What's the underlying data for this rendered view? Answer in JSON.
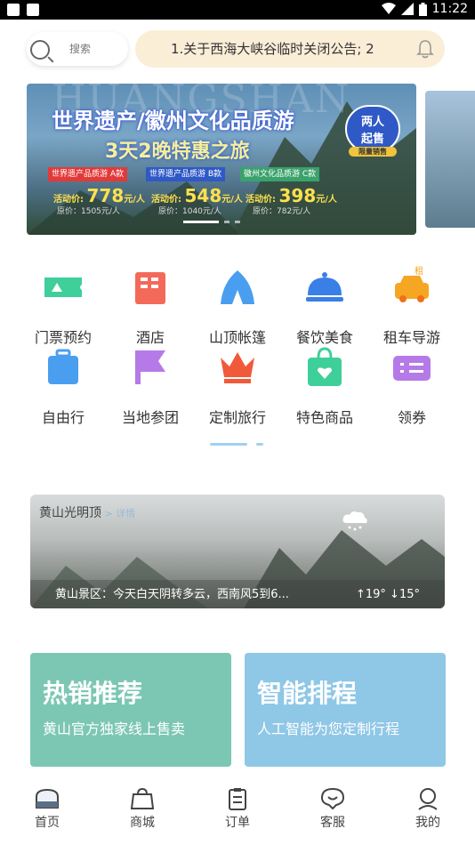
{
  "status_bar": {
    "time": "11:22"
  },
  "search": {
    "placeholder": "搜索"
  },
  "notice": {
    "text": "1.关于西海大峡谷临时关闭公告; 2"
  },
  "banner": {
    "bg_text": "HUANGSHAN",
    "title": "世界遗产/徽州文化品质游",
    "subtitle": "3天2晚特惠之旅",
    "badge_line1": "两人",
    "badge_line2": "起售",
    "badge_small": "限量销售",
    "tags": [
      "世界遗产品质游 A款",
      "世界遗产品质游 B款",
      "徽州文化品质游 C款"
    ],
    "tag_colors": [
      "#e23a3a",
      "#2f59c6",
      "#3aa26b"
    ],
    "prices": [
      {
        "label": "活动价: ",
        "value": "778",
        "unit": "元/人",
        "orig": "原价：1505元/人"
      },
      {
        "label": "活动价: ",
        "value": "548",
        "unit": "元/人",
        "orig": "原价：1040元/人"
      },
      {
        "label": "活动价: ",
        "value": "398",
        "unit": "元/人",
        "orig": "原价：782元/人"
      }
    ]
  },
  "grid": [
    {
      "label": "门票预约",
      "icon": "ticket-icon",
      "color": "#3fcf9a"
    },
    {
      "label": "酒店",
      "icon": "hotel-icon",
      "color": "#f36a5a"
    },
    {
      "label": "山顶帐篷",
      "icon": "tent-icon",
      "color": "#4a9ef0"
    },
    {
      "label": "餐饮美食",
      "icon": "food-icon",
      "color": "#3a7fe6"
    },
    {
      "label": "租车导游",
      "icon": "car-icon",
      "color": "#f5a623"
    },
    {
      "label": "自由行",
      "icon": "luggage-icon",
      "color": "#4a9ef0"
    },
    {
      "label": "当地参团",
      "icon": "flag-icon",
      "color": "#b57ae8"
    },
    {
      "label": "定制旅行",
      "icon": "crown-icon",
      "color": "#f05a3a"
    },
    {
      "label": "特色商品",
      "icon": "bag-icon",
      "color": "#3fcf9a"
    },
    {
      "label": "领券",
      "icon": "coupon-icon",
      "color": "#b57ae8"
    }
  ],
  "car_icon_badge": "租",
  "weather": {
    "location": "黄山光明顶",
    "link": " > 详情",
    "text": "黄山景区：今天白天阴转多云，西南风5到6...",
    "temp": "↑19° ↓15°"
  },
  "cards": [
    {
      "title": "热销推荐",
      "sub": "黄山官方独家线上售卖",
      "color": "#7cc7b3"
    },
    {
      "title": "智能排程",
      "sub": "人工智能为您定制行程",
      "color": "#8fc7e6"
    }
  ],
  "tabs": [
    {
      "label": "首页",
      "icon": "home-icon"
    },
    {
      "label": "商城",
      "icon": "shop-icon"
    },
    {
      "label": "订单",
      "icon": "order-icon"
    },
    {
      "label": "客服",
      "icon": "service-icon"
    },
    {
      "label": "我的",
      "icon": "profile-icon"
    }
  ]
}
